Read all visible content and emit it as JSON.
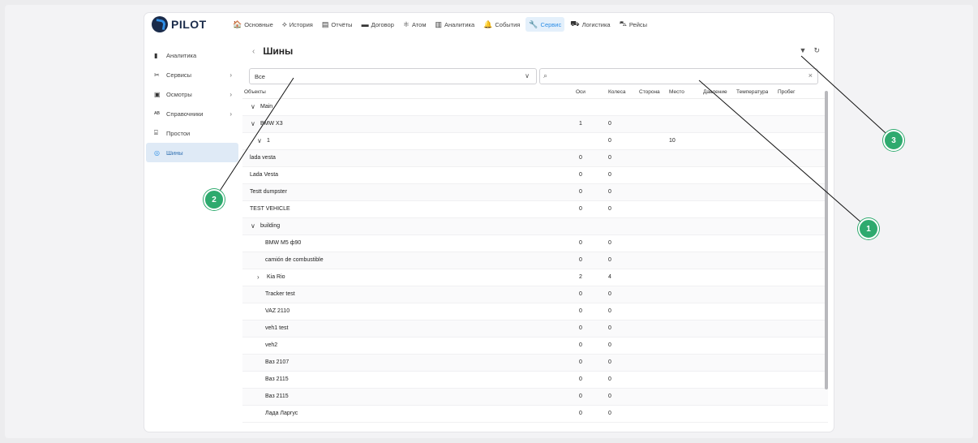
{
  "app": {
    "logo_text": "PILOT"
  },
  "topnav": [
    {
      "label": "Основные",
      "icon": "home-icon",
      "glyph": "🏠"
    },
    {
      "label": "История",
      "icon": "route-icon",
      "glyph": "⟡"
    },
    {
      "label": "Отчёты",
      "icon": "report-icon",
      "glyph": "▤"
    },
    {
      "label": "Договор",
      "icon": "contract-icon",
      "glyph": "▬"
    },
    {
      "label": "Атом",
      "icon": "atom-icon",
      "glyph": "⚛"
    },
    {
      "label": "Аналитика",
      "icon": "analytics-icon",
      "glyph": "▥"
    },
    {
      "label": "События",
      "icon": "bell-icon",
      "glyph": "🔔"
    },
    {
      "label": "Сервис",
      "icon": "wrench-icon",
      "glyph": "🔧",
      "active": true
    },
    {
      "label": "Логистика",
      "icon": "truck-icon",
      "glyph": "⛟"
    },
    {
      "label": "Рейсы",
      "icon": "bus-icon",
      "glyph": "⛍"
    }
  ],
  "sidebar": [
    {
      "label": "Аналитика",
      "icon": "bar-chart-icon",
      "glyph": "▮",
      "chevron": false
    },
    {
      "label": "Сервисы",
      "icon": "tools-icon",
      "glyph": "✂",
      "chevron": true
    },
    {
      "label": "Осмотры",
      "icon": "clipboard-icon",
      "glyph": "▣",
      "chevron": true
    },
    {
      "label": "Справочники",
      "icon": "spellcheck-icon",
      "glyph": "ᴬᴮ",
      "chevron": true
    },
    {
      "label": "Простои",
      "icon": "downtime-icon",
      "glyph": "⌸",
      "chevron": false
    },
    {
      "label": "Шины",
      "icon": "tire-icon",
      "glyph": "◎",
      "chevron": false,
      "active": true
    }
  ],
  "header": {
    "back": "‹",
    "title": "Шины"
  },
  "filter": {
    "select_value": "Все",
    "search_placeholder": ""
  },
  "columns": [
    "Объекты",
    "Оси",
    "Колеса",
    "Сторона",
    "Место",
    "Давление",
    "Температура",
    "Пробег"
  ],
  "rows": [
    {
      "name": "Main",
      "level": 0,
      "toggle": "∨",
      "axles": "",
      "wheels": "",
      "place": ""
    },
    {
      "name": "BMW X3",
      "level": 0,
      "toggle": "∨",
      "axles": "1",
      "wheels": "0",
      "place": ""
    },
    {
      "name": "1",
      "level": 1,
      "toggle": "∨",
      "axles": "",
      "wheels": "0",
      "place": "10"
    },
    {
      "name": "lada vesta",
      "level": 0,
      "toggle": "",
      "axles": "0",
      "wheels": "0",
      "place": ""
    },
    {
      "name": "Lada Vesta",
      "level": 0,
      "toggle": "",
      "axles": "0",
      "wheels": "0",
      "place": ""
    },
    {
      "name": "Testt dumpster",
      "level": 0,
      "toggle": "",
      "axles": "0",
      "wheels": "0",
      "place": ""
    },
    {
      "name": "TEST VEHICLE",
      "level": 0,
      "toggle": "",
      "axles": "0",
      "wheels": "0",
      "place": ""
    },
    {
      "name": "building",
      "level": 0,
      "toggle": "∨",
      "axles": "",
      "wheels": "",
      "place": ""
    },
    {
      "name": "BMW M5 ф90",
      "level": 1,
      "toggle": "",
      "axles": "0",
      "wheels": "0",
      "place": ""
    },
    {
      "name": "camión de combustible",
      "level": 1,
      "toggle": "",
      "axles": "0",
      "wheels": "0",
      "place": ""
    },
    {
      "name": "Kia Rio",
      "level": 1,
      "toggle": "›",
      "axles": "2",
      "wheels": "4",
      "place": ""
    },
    {
      "name": "Tracker test",
      "level": 1,
      "toggle": "",
      "axles": "0",
      "wheels": "0",
      "place": ""
    },
    {
      "name": "VAZ 2110",
      "level": 1,
      "toggle": "",
      "axles": "0",
      "wheels": "0",
      "place": ""
    },
    {
      "name": "veh1 test",
      "level": 1,
      "toggle": "",
      "axles": "0",
      "wheels": "0",
      "place": ""
    },
    {
      "name": "veh2",
      "level": 1,
      "toggle": "",
      "axles": "0",
      "wheels": "0",
      "place": ""
    },
    {
      "name": "Ваз 2107",
      "level": 1,
      "toggle": "",
      "axles": "0",
      "wheels": "0",
      "place": ""
    },
    {
      "name": "Ваз 2115",
      "level": 1,
      "toggle": "",
      "axles": "0",
      "wheels": "0",
      "place": ""
    },
    {
      "name": "Ваз 2115",
      "level": 1,
      "toggle": "",
      "axles": "0",
      "wheels": "0",
      "place": ""
    },
    {
      "name": "Лада Ларгус",
      "level": 1,
      "toggle": "",
      "axles": "0",
      "wheels": "0",
      "place": ""
    }
  ],
  "callouts": [
    {
      "label": "1"
    },
    {
      "label": "2"
    },
    {
      "label": "3"
    }
  ],
  "colors": {
    "accent": "#2f8fe6",
    "callout": "#2eaa6e",
    "brand": "#1a2b4a"
  }
}
